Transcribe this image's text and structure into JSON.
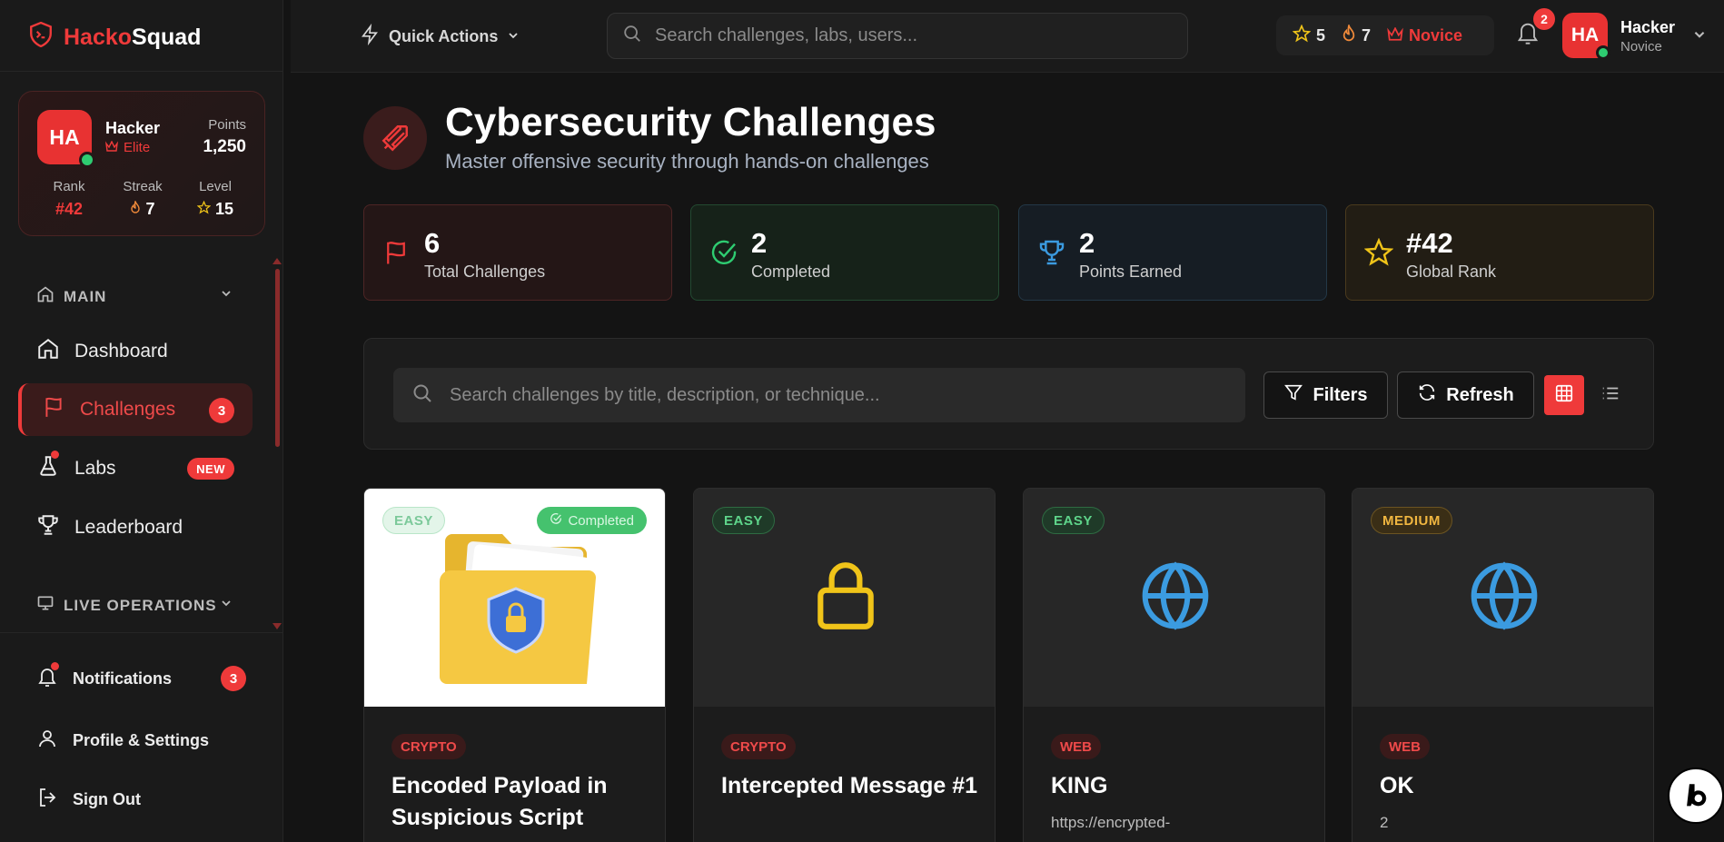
{
  "brand": {
    "name_part1": "Hacko",
    "name_part2": "Squad",
    "accent": "#ef3a3a"
  },
  "profile_card": {
    "initials": "HA",
    "name": "Hacker",
    "tier": "Elite",
    "points_label": "Points",
    "points_value": "1,250",
    "rank_label": "Rank",
    "rank_value": "#42",
    "streak_label": "Streak",
    "streak_value": "7",
    "level_label": "Level",
    "level_value": "15"
  },
  "sidebar": {
    "section_main": "MAIN",
    "items": [
      {
        "label": "Dashboard",
        "icon": "home-icon"
      },
      {
        "label": "Challenges",
        "icon": "flag-icon",
        "badge": "3",
        "active": true
      },
      {
        "label": "Labs",
        "icon": "flask-icon",
        "badge": "NEW"
      },
      {
        "label": "Leaderboard",
        "icon": "trophy-icon"
      }
    ],
    "section_live": "LIVE OPERATIONS",
    "bottom": [
      {
        "label": "Notifications",
        "icon": "bell-icon",
        "badge": "3"
      },
      {
        "label": "Profile & Settings",
        "icon": "user-icon"
      },
      {
        "label": "Sign Out",
        "icon": "logout-icon"
      }
    ]
  },
  "topbar": {
    "quick_actions": "Quick Actions",
    "search_placeholder": "Search challenges, labs, users...",
    "stars": "5",
    "streak": "7",
    "rank": "Novice",
    "notif_count": "2",
    "user_initials": "HA",
    "user_name": "Hacker",
    "user_role": "Novice"
  },
  "hero": {
    "title": "Cybersecurity Challenges",
    "subtitle": "Master offensive security through hands-on challenges"
  },
  "stats": [
    {
      "value": "6",
      "label": "Total Challenges",
      "color": "#ef3a3a"
    },
    {
      "value": "2",
      "label": "Completed",
      "color": "#2ecc71"
    },
    {
      "value": "2",
      "label": "Points Earned",
      "color": "#3b9be0"
    },
    {
      "value": "#42",
      "label": "Global Rank",
      "color": "#f0c419"
    }
  ],
  "filters": {
    "search_placeholder": "Search challenges by title, description, or technique...",
    "filters_label": "Filters",
    "refresh_label": "Refresh"
  },
  "cards": [
    {
      "difficulty": "EASY",
      "status": "Completed",
      "category": "CRYPTO",
      "title": "Encoded Payload in Suspicious Script",
      "icon": "folder-shield-image"
    },
    {
      "difficulty": "EASY",
      "category": "CRYPTO",
      "title": "Intercepted Message #1",
      "icon": "lock-icon",
      "icon_color": "#f0c419"
    },
    {
      "difficulty": "EASY",
      "category": "WEB",
      "title": "KING",
      "desc": "https://encrypted-",
      "icon": "globe-icon",
      "icon_color": "#3b9be0"
    },
    {
      "difficulty": "MEDIUM",
      "category": "WEB",
      "title": "OK",
      "desc": "2",
      "icon": "globe-icon",
      "icon_color": "#3b9be0"
    }
  ]
}
